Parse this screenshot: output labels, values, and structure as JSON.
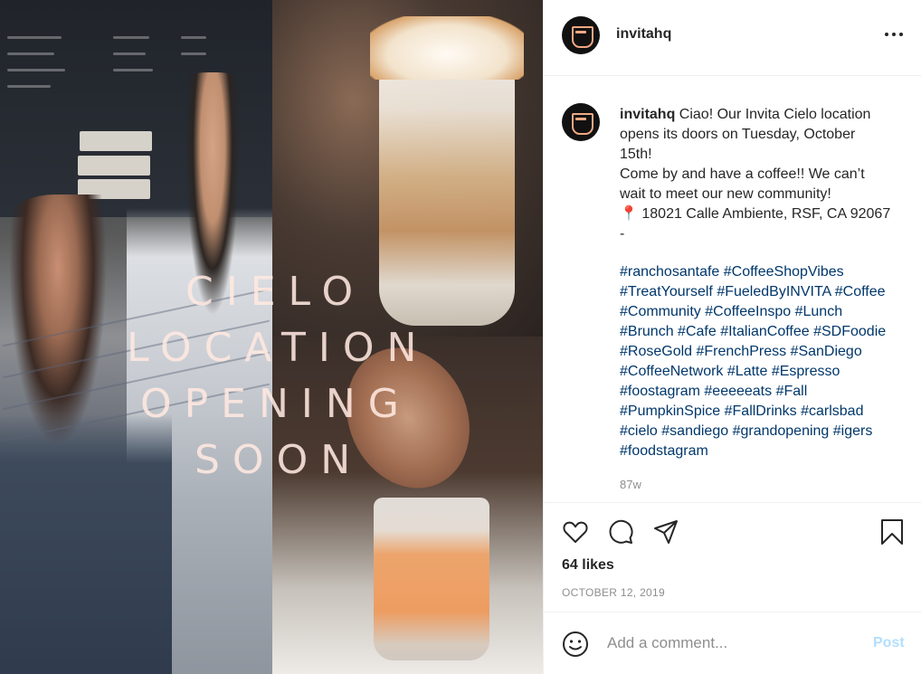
{
  "post": {
    "username": "invitahq",
    "image": {
      "overlay_lines": [
        "CIELO",
        "LOCATION",
        "OPENING",
        "SOON"
      ]
    },
    "caption": {
      "username": "invitahq",
      "text": "Ciao! Our Invita Cielo location opens its doors on Tuesday, October 15th!\nCome by and have a coffee!! We can’t wait to meet our new community!\n📍 18021 Calle Ambiente, RSF, CA 92067 -",
      "hashtags": [
        "#ranchosantafe",
        "#CoffeeShopVibes",
        "#TreatYourself",
        "#FueledByINVITA",
        "#Coffee",
        "#Community",
        "#CoffeeInspo",
        "#Lunch",
        "#Brunch",
        "#Cafe",
        "#ItalianCoffee",
        "#SDFoodie",
        "#RoseGold",
        "#FrenchPress",
        "#SanDiego",
        "#CoffeeNetwork",
        "#Latte",
        "#Espresso",
        "#foostagram",
        "#eeeeeats",
        "#Fall",
        "#PumpkinSpice",
        "#FallDrinks",
        "#carlsbad",
        "#cielo",
        "#sandiego",
        "#grandopening",
        "#igers",
        "#foodstagram"
      ],
      "time_ago": "87w"
    },
    "likes": "64 likes",
    "date": "OCTOBER 12, 2019",
    "comment": {
      "placeholder": "Add a comment...",
      "post_label": "Post"
    },
    "colors": {
      "hashtag": "#00376b",
      "post_button": "#b2dffc",
      "avatar_accent": "#f0a883"
    },
    "icons": [
      "more-options-icon",
      "heart-icon",
      "comment-icon",
      "share-icon",
      "bookmark-icon",
      "emoji-icon"
    ]
  }
}
